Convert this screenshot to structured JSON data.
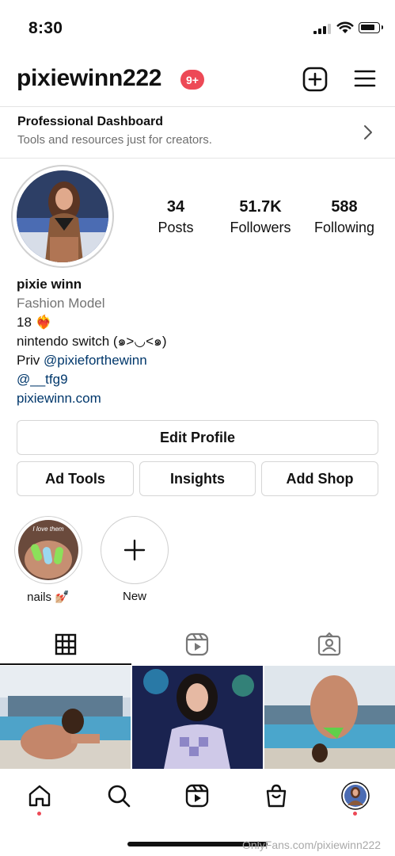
{
  "status_bar": {
    "time": "8:30"
  },
  "header": {
    "username": "pixiewinn222",
    "notification_badge": "9+"
  },
  "dashboard": {
    "title": "Professional Dashboard",
    "subtitle": "Tools and resources just for creators."
  },
  "stats": [
    {
      "value": "34",
      "label": "Posts"
    },
    {
      "value": "51.7K",
      "label": "Followers"
    },
    {
      "value": "588",
      "label": "Following"
    }
  ],
  "bio": {
    "name": "pixie winn",
    "category": "Fashion Model",
    "line1": "18 ❤️‍🔥",
    "line2": "nintendo switch (๑>◡<๑)",
    "line3_prefix": "Priv ",
    "line3_mention": "@pixieforthewinn",
    "line4": "@__tfg9",
    "website": "pixiewinn.com"
  },
  "buttons": {
    "edit_profile": "Edit Profile",
    "ad_tools": "Ad Tools",
    "insights": "Insights",
    "add_shop": "Add Shop"
  },
  "highlights": [
    {
      "label": "nails 💅🏼",
      "thumb_text": "I love them"
    },
    {
      "label": "New"
    }
  ],
  "tabs": [
    "grid-icon",
    "reels-icon",
    "tagged-icon"
  ],
  "bottom_nav": [
    "home-icon",
    "search-icon",
    "reels-icon",
    "shop-icon",
    "profile-avatar"
  ],
  "watermark": "OnlyFans.com/pixiewinn222",
  "colors": {
    "badge": "#ed4956",
    "link": "#00376b",
    "secondary_text": "#737373",
    "border": "#d6d6d6"
  }
}
